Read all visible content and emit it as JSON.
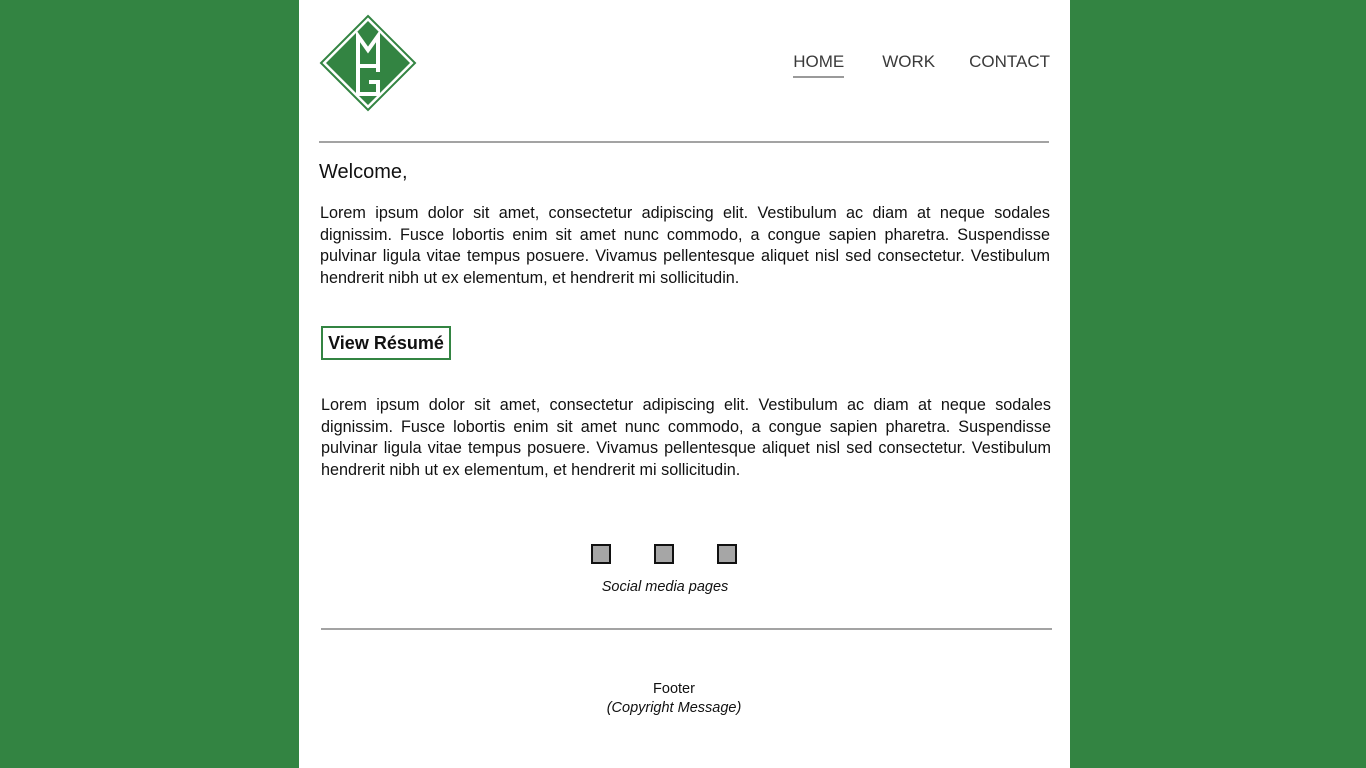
{
  "colors": {
    "background": "#338442",
    "accent": "#338442",
    "rule": "#a3a3a3",
    "social_icon_fill": "#a6a6a6"
  },
  "logo": {
    "text": "MG",
    "icon": "mg-diamond-logo"
  },
  "nav": {
    "items": [
      {
        "label": "HOME",
        "active": true
      },
      {
        "label": "WORK",
        "active": false
      },
      {
        "label": "CONTACT",
        "active": false
      }
    ]
  },
  "main": {
    "greeting": "Welcome,",
    "paragraph_1": "Lorem ipsum dolor sit amet, consectetur adipiscing elit. Vestibulum ac diam at neque sodales dignissim. Fusce lobortis enim sit amet nunc commodo, a congue sapien pharetra. Suspendisse pulvinar ligula vitae tempus posuere. Vivamus pellentesque aliquet nisl sed consectetur. Vestibulum hendrerit nibh ut ex elementum, et hendrerit mi sollicitudin.",
    "resume_button": "View Résumé",
    "paragraph_2": "Lorem ipsum dolor sit amet, consectetur adipiscing elit. Vestibulum ac diam at neque sodales dignissim. Fusce lobortis enim sit amet nunc commodo, a congue sapien pharetra. Suspendisse pulvinar ligula vitae tempus posuere. Vivamus pellentesque aliquet nisl sed consectetur. Vestibulum hendrerit nibh ut ex elementum, et hendrerit mi sollicitudin."
  },
  "social": {
    "icons": [
      "social-icon-placeholder",
      "social-icon-placeholder",
      "social-icon-placeholder"
    ],
    "caption": "Social media pages"
  },
  "footer": {
    "title": "Footer",
    "copyright": "(Copyright Message)"
  }
}
